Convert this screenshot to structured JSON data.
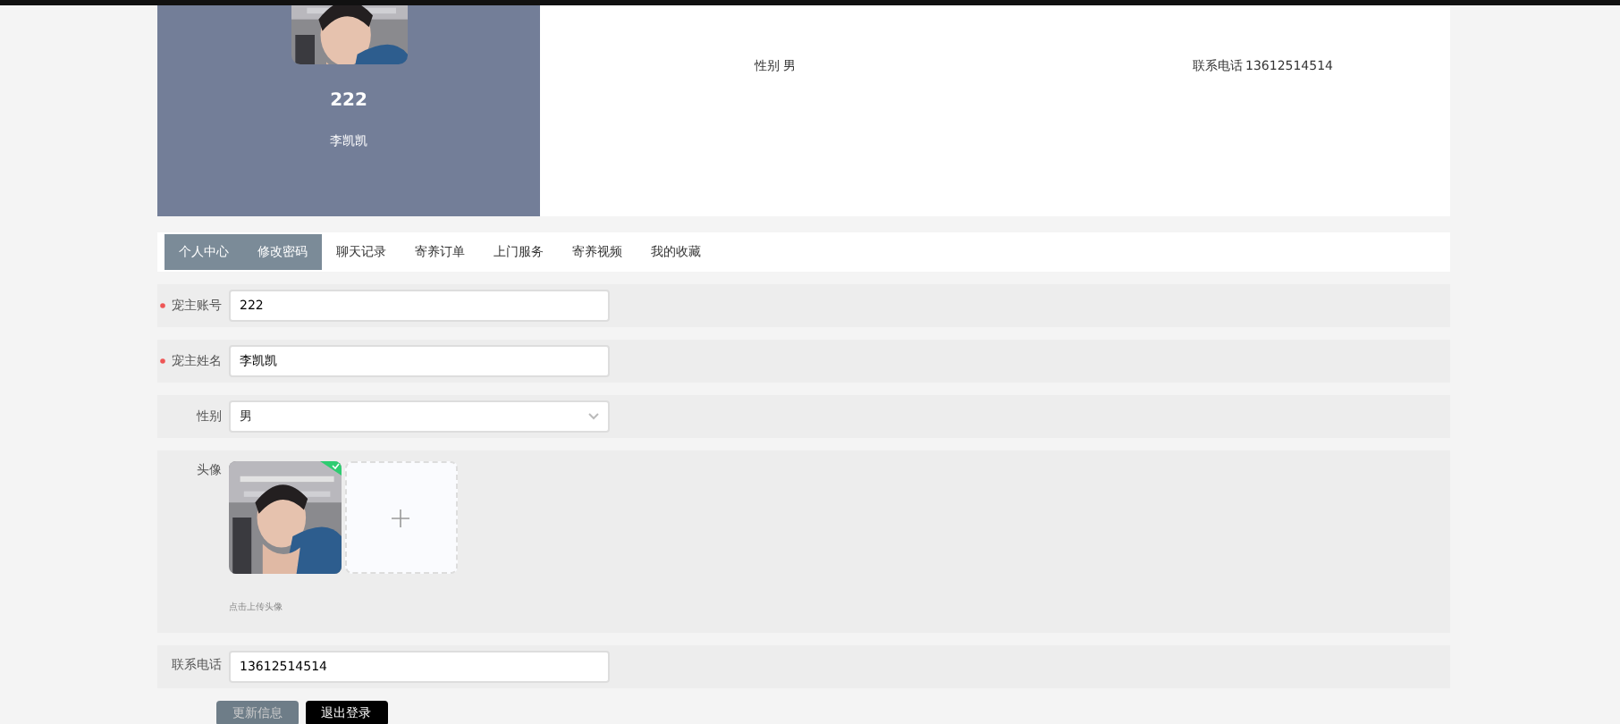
{
  "profile": {
    "account": "222",
    "name": "李凯凯"
  },
  "info": [
    {
      "label": "性别",
      "value": "男"
    },
    {
      "label": "联系电话",
      "value": "13612514514"
    }
  ],
  "tabs": [
    {
      "label": "个人中心",
      "selected": true
    },
    {
      "label": "修改密码",
      "selected": true
    },
    {
      "label": "聊天记录",
      "selected": false
    },
    {
      "label": "寄养订单",
      "selected": false
    },
    {
      "label": "上门服务",
      "selected": false
    },
    {
      "label": "寄养视频",
      "selected": false
    },
    {
      "label": "我的收藏",
      "selected": false
    }
  ],
  "form": [
    {
      "kind": "text",
      "label": "宠主账号",
      "required": true,
      "value": "222"
    },
    {
      "kind": "text",
      "label": "宠主姓名",
      "required": true,
      "value": "李凯凯"
    },
    {
      "kind": "select",
      "label": "性别",
      "required": false,
      "value": "男"
    },
    {
      "kind": "upload",
      "label": "头像",
      "required": false,
      "hint": "点击上传头像"
    },
    {
      "kind": "text",
      "label": "联系电话",
      "required": false,
      "value": "13612514514"
    }
  ],
  "buttons": [
    {
      "label": "更新信息",
      "kind": "primary"
    },
    {
      "label": "退出登录",
      "kind": "dark"
    }
  ]
}
